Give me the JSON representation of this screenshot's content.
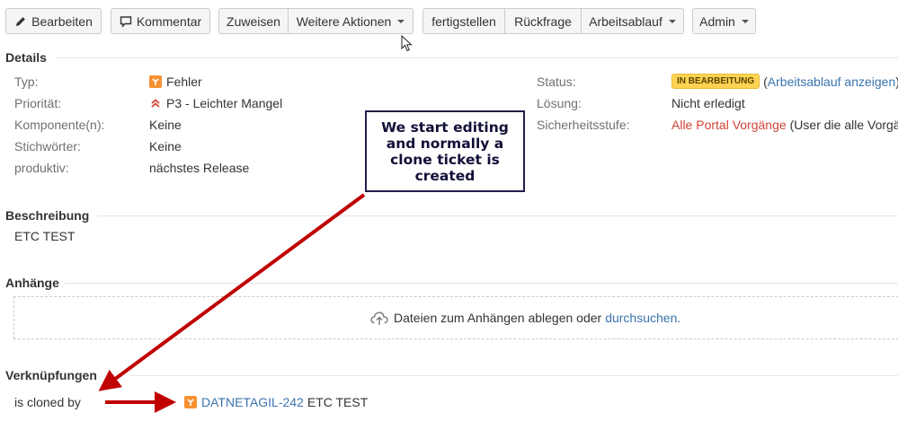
{
  "toolbar": {
    "edit_label": "Bearbeiten",
    "comment_label": "Kommentar",
    "assign_label": "Zuweisen",
    "more_actions_label": "Weitere Aktionen",
    "finish_label": "fertigstellen",
    "query_label": "Rückfrage",
    "workflow_label": "Arbeitsablauf",
    "admin_label": "Admin"
  },
  "details": {
    "title": "Details",
    "left": [
      {
        "label": "Typ:",
        "value": "Fehler"
      },
      {
        "label": "Priorität:",
        "value": "P3 - Leichter Mangel"
      },
      {
        "label": "Komponente(n):",
        "value": "Keine"
      },
      {
        "label": "Stichwörter:",
        "value": "Keine"
      },
      {
        "label": "produktiv:",
        "value": "nächstes Release"
      }
    ],
    "right": {
      "status_label": "Status:",
      "status_value": "IN BEARBEITUNG",
      "status_paren_open": "(",
      "status_link": "Arbeitsablauf anzeigen",
      "status_paren_close": ")",
      "resolution_label": "Lösung:",
      "resolution_value": "Nicht erledigt",
      "security_label": "Sicherheitsstufe:",
      "security_value": "Alle Portal Vorgänge",
      "security_note": "(User die alle Vorgän"
    }
  },
  "description": {
    "title": "Beschreibung",
    "text": "ETC TEST"
  },
  "attachments": {
    "title": "Anhänge",
    "drop_text": "Dateien zum Anhängen ablegen oder",
    "browse_link": "durchsuchen",
    "period": "."
  },
  "links": {
    "title": "Verknüpfungen",
    "relation": "is cloned by",
    "issue_key": "DATNETAGIL-242",
    "issue_summary": "ETC TEST"
  },
  "annotation": {
    "text": "We start editing and normally a clone ticket is created"
  },
  "colors": {
    "link": "#3b73af",
    "bug_icon": "#f79232",
    "status_lozenge": "#ffd351",
    "arrow": "#c00000",
    "security": "#d04437"
  }
}
